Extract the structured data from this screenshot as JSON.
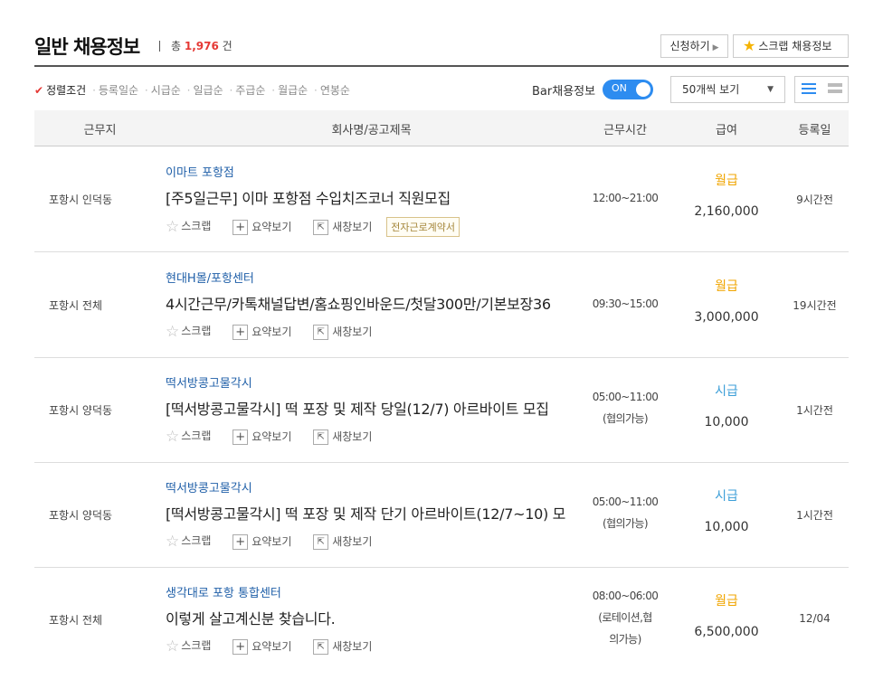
{
  "header": {
    "title": "일반 채용정보",
    "count_prefix": "총",
    "count": "1,976",
    "count_suffix": "건",
    "apply_label": "신청하기",
    "scrap_label": "스크랩 채용정보"
  },
  "sort": {
    "active": "정렬조건",
    "options": [
      "등록일순",
      "시급순",
      "일급순",
      "주급순",
      "월급순",
      "연봉순"
    ]
  },
  "bar_toggle": {
    "label": "Bar채용정보",
    "state": "ON"
  },
  "page_size": {
    "selected": "50개씩 보기"
  },
  "columns": [
    "근무지",
    "회사명/공고제목",
    "근무시간",
    "급여",
    "등록일"
  ],
  "actions": {
    "scrap": "스크랩",
    "summary": "요약보기",
    "new_window": "새창보기"
  },
  "colors": {
    "monthly": "#f0a500",
    "hourly": "#3d9fd8",
    "accent": "#e53935",
    "company": "#1f5fa8"
  },
  "jobs": [
    {
      "location": "포항시 인덕동",
      "company": "이마트 포항점",
      "title": "[주5일근무] 이마 포항점 수입치즈코너 직원모집",
      "time": [
        "12:00~21:00"
      ],
      "pay_type": "월급",
      "pay_amount": "2,160,000",
      "registered": "9시간전",
      "badge": "전자근로계약서"
    },
    {
      "location": "포항시 전체",
      "company": "현대H몰/포항센터",
      "title": "4시간근무/카톡채널답변/홈쇼핑인바운드/첫달300만/기본보장36",
      "time": [
        "09:30~15:00"
      ],
      "pay_type": "월급",
      "pay_amount": "3,000,000",
      "registered": "19시간전",
      "badge": ""
    },
    {
      "location": "포항시 양덕동",
      "company": "떡서방콩고물각시",
      "title": "[떡서방콩고물각시] 떡 포장 및 제작 당일(12/7) 아르바이트 모집",
      "time": [
        "05:00~11:00",
        "(협의가능)"
      ],
      "pay_type": "시급",
      "pay_amount": "10,000",
      "registered": "1시간전",
      "badge": ""
    },
    {
      "location": "포항시 양덕동",
      "company": "떡서방콩고물각시",
      "title": "[떡서방콩고물각시] 떡 포장 및 제작 단기 아르바이트(12/7~10) 모",
      "time": [
        "05:00~11:00",
        "(협의가능)"
      ],
      "pay_type": "시급",
      "pay_amount": "10,000",
      "registered": "1시간전",
      "badge": ""
    },
    {
      "location": "포항시 전체",
      "company": "생각대로 포항 통합센터",
      "title": "이렇게 살고계신분 찾습니다.",
      "time": [
        "08:00~06:00",
        "(로테이션,협",
        "의가능)"
      ],
      "pay_type": "월급",
      "pay_amount": "6,500,000",
      "registered": "12/04",
      "badge": ""
    }
  ]
}
